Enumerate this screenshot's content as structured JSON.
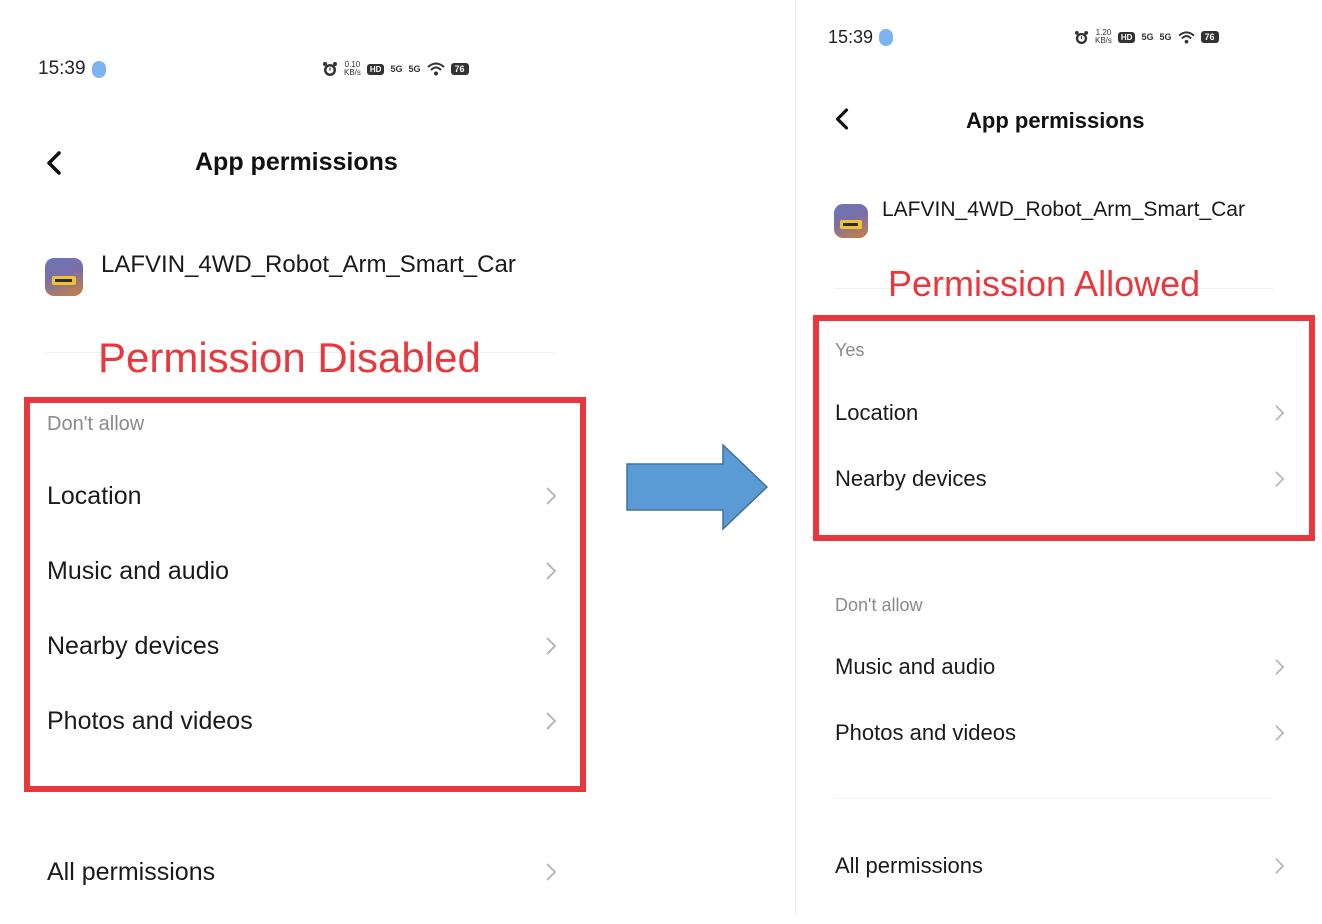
{
  "left": {
    "status": {
      "time": "15:39",
      "net_speed_top": "0.10",
      "net_speed_unit": "KB/s",
      "hd": "HD",
      "sig1": "5G",
      "sig2": "5G",
      "battery": "76"
    },
    "header": {
      "title": "App permissions"
    },
    "app": {
      "name": "LAFVIN_4WD_Robot_Arm_Smart_Car"
    },
    "annotation": "Permission Disabled",
    "section_label": "Don't allow",
    "items": [
      "Location",
      "Music and audio",
      "Nearby devices",
      "Photos and videos"
    ],
    "all_permissions": "All permissions"
  },
  "right": {
    "status": {
      "time": "15:39",
      "net_speed_top": "1.20",
      "net_speed_unit": "KB/s",
      "hd": "HD",
      "sig1": "5G",
      "sig2": "5G",
      "battery": "76"
    },
    "header": {
      "title": "App permissions"
    },
    "app": {
      "name": "LAFVIN_4WD_Robot_Arm_Smart_Car"
    },
    "annotation": "Permission Allowed",
    "allowed_label": "Yes",
    "allowed_items": [
      "Location",
      "Nearby devices"
    ],
    "denied_label": "Don't allow",
    "denied_items": [
      "Music and audio",
      "Photos and videos"
    ],
    "all_permissions": "All permissions"
  },
  "colors": {
    "annotation_red": "#e8383d",
    "arrow_blue": "#5b9bd5",
    "arrow_border": "#41719c"
  }
}
